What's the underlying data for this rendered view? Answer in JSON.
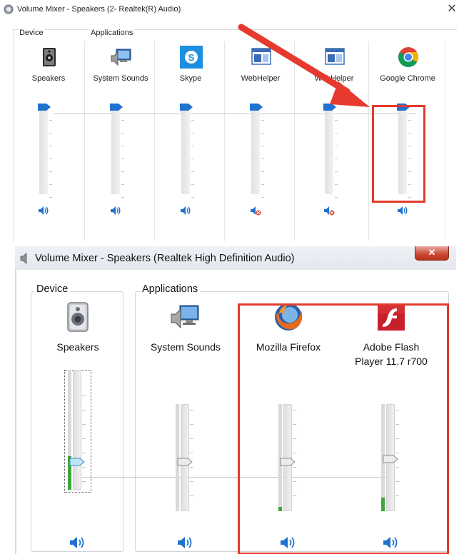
{
  "top_window": {
    "title": "Volume Mixer - Speakers (2- Realtek(R) Audio)",
    "close_glyph": "✕",
    "device_header": "Device",
    "applications_header": "Applications",
    "columns": [
      {
        "name": "Speakers",
        "icon": "speaker-device-icon",
        "volume": 1.0,
        "muted": false
      },
      {
        "name": "System Sounds",
        "icon": "system-sounds-icon",
        "volume": 1.0,
        "muted": false
      },
      {
        "name": "Skype",
        "icon": "skype-icon",
        "volume": 1.0,
        "muted": false
      },
      {
        "name": "WebHelper",
        "icon": "webhelper-icon",
        "volume": 1.0,
        "muted": true
      },
      {
        "name": "WebHelper",
        "icon": "webhelper-icon",
        "volume": 1.0,
        "muted": true
      },
      {
        "name": "Google Chrome",
        "icon": "chrome-icon",
        "volume": 1.0,
        "muted": false
      }
    ]
  },
  "bottom_window": {
    "title": "Volume Mixer - Speakers (Realtek High Definition Audio)",
    "close_glyph": "✕",
    "device_header": "Device",
    "applications_header": "Applications",
    "columns": [
      {
        "name": "Speakers",
        "icon": "speaker-device-icon",
        "volume": 0.35,
        "meter_level": 0.28,
        "muted": false
      },
      {
        "name": "System Sounds",
        "icon": "system-sounds-icon",
        "volume": 0.35,
        "meter_level": 0.0,
        "muted": false
      },
      {
        "name": "Mozilla Firefox",
        "icon": "firefox-icon",
        "volume": 0.35,
        "meter_level": 0.04,
        "muted": false
      },
      {
        "name": "Adobe Flash Player 11.7 r700",
        "icon": "flash-player-icon",
        "volume": 0.37,
        "meter_level": 0.13,
        "muted": false
      }
    ]
  },
  "colors": {
    "highlight": "#e33b2e",
    "accent_blue": "#1f73d0",
    "meter_green": "#3ca63c"
  }
}
